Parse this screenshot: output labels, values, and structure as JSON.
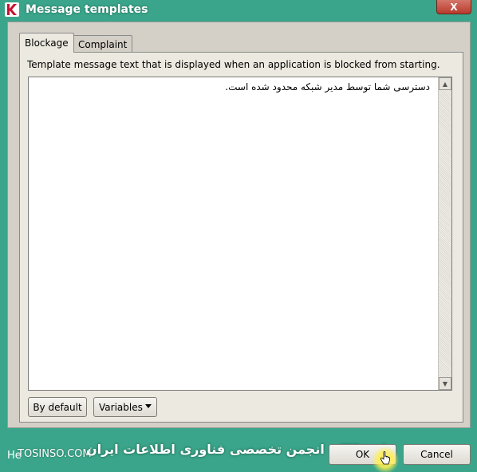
{
  "window": {
    "title": "Message templates",
    "close_label": "X"
  },
  "tabs": [
    {
      "label": "Blockage",
      "active": true
    },
    {
      "label": "Complaint",
      "active": false
    }
  ],
  "panel": {
    "description": "Template message text that is displayed when an application is blocked from starting.",
    "message_text": "دسترسی شما توسط مدیر شبکه محدود شده است.",
    "by_default_label": "By default",
    "variables_label": "Variables"
  },
  "footer": {
    "help_label": "He",
    "watermark_site": "TOSINSO.COM",
    "watermark_arabic": "ITPro.ir - انجمن تخصصی فناوری اطلاعات ایران",
    "ok_label": "OK",
    "cancel_label": "Cancel"
  },
  "colors": {
    "frame": "#3aa58a",
    "close_button": "#c24a3c",
    "dialog_bg": "#d4d0c8"
  }
}
